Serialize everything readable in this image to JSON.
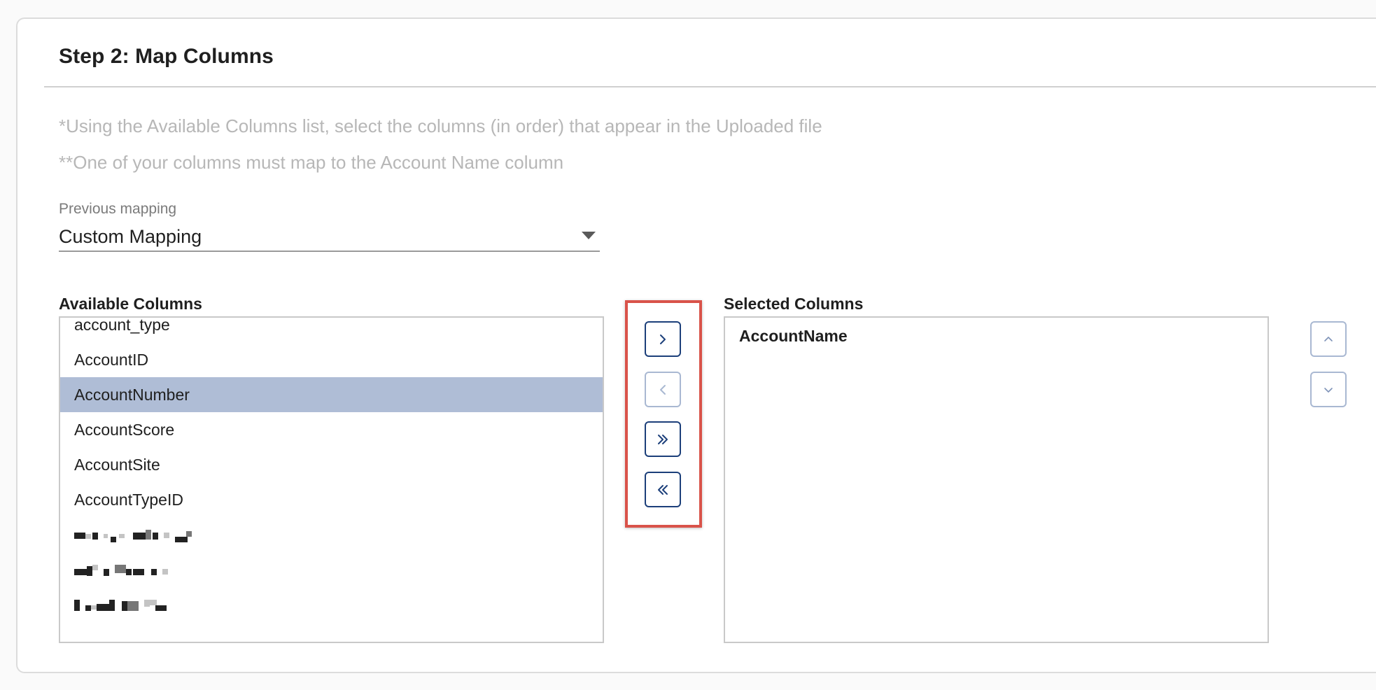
{
  "step": {
    "title": "Step 2: Map Columns",
    "hint_1": "*Using the Available Columns list, select the columns (in order) that appear in the Uploaded file",
    "hint_2": "**One of your columns must map to the Account Name column"
  },
  "mapping": {
    "label": "Previous mapping",
    "value": "Custom Mapping"
  },
  "available": {
    "heading": "Available Columns",
    "items": [
      "account_type",
      "AccountID",
      "AccountNumber",
      "AccountScore",
      "AccountSite",
      "AccountTypeID"
    ],
    "selected_item": "AccountNumber"
  },
  "selected": {
    "heading": "Selected Columns",
    "items": [
      "AccountName"
    ]
  },
  "icons": {
    "move_right": "chevron-right-icon",
    "move_left": "chevron-left-icon",
    "move_all_right": "double-chevron-right-icon",
    "move_all_left": "double-chevron-left-icon",
    "move_up": "chevron-up-icon",
    "move_down": "chevron-down-icon"
  },
  "colors": {
    "accent": "#1c3f7a",
    "accent_disabled": "#a9b8d2",
    "selection": "#afbdd6",
    "annotation": "#d9534a",
    "hint_text": "#b7b7b7"
  }
}
